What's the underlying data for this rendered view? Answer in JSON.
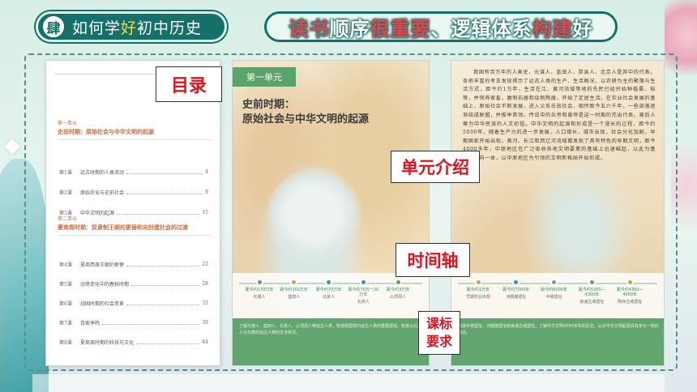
{
  "header": {
    "badge_number": "肆",
    "badge_title_pre": "如何学",
    "badge_title_em": "好",
    "badge_title_post": "初中历史",
    "main_title_parts": [
      {
        "text": "读书",
        "em": true
      },
      {
        "text": "顺序",
        "em": false
      },
      {
        "text": "很重要",
        "em": true
      },
      {
        "text": "、逻辑体系",
        "em": false
      },
      {
        "text": "构建",
        "em": true
      },
      {
        "text": "好",
        "em": false
      }
    ]
  },
  "callouts": {
    "toc": "目录",
    "unit_intro": "单元介绍",
    "timeline": "时间轴",
    "requirement_line1": "课标",
    "requirement_line2": "要求"
  },
  "toc": {
    "units": [
      {
        "tag": "第一单元",
        "name": "史前时期：原始社会与中华文明的起源",
        "lessons": [
          {
            "num": "第1课",
            "title": "远古时期的人类活动",
            "page": "4"
          },
          {
            "num": "第2课",
            "title": "原始农业与史前社会",
            "page": "9"
          },
          {
            "num": "第3课",
            "title": "中华文明的起源",
            "page": "15"
          }
        ]
      },
      {
        "tag": "第二单元",
        "name": "夏商周时期：奴隶制王朝的更替和向封建社会的过渡",
        "lessons": [
          {
            "num": "第4课",
            "title": "夏商西周王朝的更替",
            "page": "22"
          },
          {
            "num": "第5课",
            "title": "动荡变化中的春秋时期",
            "page": "28"
          },
          {
            "num": "第6课",
            "title": "战国时期的社会变革",
            "page": "33"
          },
          {
            "num": "第7课",
            "title": "百家争鸣",
            "page": "39"
          },
          {
            "num": "第8课",
            "title": "夏商周时期的科技与文化",
            "page": "44"
          }
        ]
      }
    ]
  },
  "unit_page": {
    "ribbon": "第一单元",
    "heading_line1": "史前时期：",
    "heading_line2": "原始社会与中华文明的起源",
    "timeline": [
      {
        "date": "距今约170万年",
        "label": "元谋人",
        "color": "#5aa36a"
      },
      {
        "date": "距今约102万年",
        "label": "蓝田人",
        "color": "#d0a53a"
      },
      {
        "date": "距今约70万年",
        "label": "北京人",
        "color": "#3b8fc4"
      },
      {
        "date": "距今约70万一20万年",
        "label": "北京人",
        "color": "#3b8fc4"
      },
      {
        "date": "距今约3万年",
        "label": "山顶洞人",
        "color": "#5aa36a"
      }
    ],
    "requirement_text": "了解元谋人、蓝田人、北京人、山顶洞人等远古人类，知道我国境内远古人类的重要遗址。知道以北京人为代表的远古人类的生活状况。"
  },
  "text_page": {
    "paragraph": "我国有百万年的人类史，元谋人、蓝田人、郧县人、北京人是其中的代表。各地丰富的考古发现揭示了远古人类的生产、生活概况。以农耕为主的聚落与生活方式，距今约1万年，生活在江、黄河流域等地的先民已经开始种植粟、稻等，并饲养家畜，磨制石器和烧制陶器，开始了定居生活。在农业社会发展的基础上，原始社会不断发展，进入父系氏族社会，相传距今五六千年，一些部落逐渐结成联盟，并推举首领。传说中的炎帝和黄帝是这一时期的杰出代表。被后人尊为中华民族的人文初祖。中华文明的起源和形成是一个漫长的过程，距今约5000年，随着生产力的进一步发展，人口增长，城市出现，社会分化加剧，早期国家开始出现。黄河、长江和西辽河流域都发现了具有特色的早期文明，距今4000多年，中原地区在广泛吸收各地文明要素的基础上迅速崛起，以此为基础，走向一体，以中原地区为引领的文明新格局开始形成。",
    "timeline": [
      {
        "date": "距今约1万年",
        "label": "早期农业出现",
        "color": "#d0a53a"
      },
      {
        "date": "距今约7000年",
        "label": "河姆渡遗址",
        "color": "#3b8fc4"
      },
      {
        "date": "距今约6000年",
        "label": "半坡遗址",
        "color": "#8e8e8e"
      },
      {
        "date": "距今约5300—4300年",
        "label": "良渚古城遗址",
        "color": "#5aa36a"
      },
      {
        "date": "距今约4300—4000年",
        "label": "陶寺古城遗址",
        "color": "#d0a53a"
      }
    ],
    "requirement_text": "知道半坡遗址、河姆渡遗址和良渚古城遗址，了解中华文明5000多年的历史。认识中华文明起源具有多元一体的特点。"
  }
}
